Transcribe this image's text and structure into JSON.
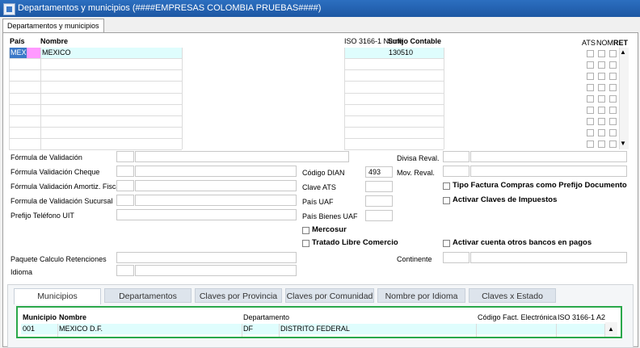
{
  "window": {
    "title": "Departamentos y municipios (####EMPRESAS COLOMBIA PRUEBAS####)"
  },
  "main_tab": "Departamentos y municipios",
  "grid": {
    "headers": {
      "pais": "País",
      "nombre": "Nombre",
      "iso": "ISO 3166-1 Nume",
      "sufijo": "Sufijo Contable",
      "ats": "ATS",
      "nom": "NOM.",
      "ret": "RET"
    },
    "row": {
      "pais": "MEX",
      "nombre": "MEXICO",
      "sufijo": "130510"
    }
  },
  "form": {
    "formula_validacion": "Fórmula de Validación",
    "formula_validacion_cheque": "Fórmula Validación Cheque",
    "formula_validacion_amortiz": "Fórmula Validación Amortiz. Fiscal",
    "formula_validacion_sucursal": "Formula de Validación Sucursal",
    "prefijo_telefono": "Prefijo Teléfono UIT",
    "paquete_calculo": "Paquete Calculo Retenciones",
    "idioma": "Idioma",
    "codigo_dian_label": "Código DIAN",
    "codigo_dian_value": "493",
    "clave_ats": "Clave ATS",
    "pais_uaf": "País UAF",
    "pais_bienes_uaf": "País Bienes UAF",
    "divisa_reval": "Divisa Reval.",
    "mov_reval": "Mov. Reval.",
    "continente": "Continente",
    "mercosur": "Mercosur",
    "tratado": "Tratado Libre Comercio",
    "tipo_factura": "Tipo Factura Compras como Prefijo Documento",
    "activar_claves": "Activar Claves de Impuestos",
    "activar_cuenta": "Activar cuenta otros bancos en pagos"
  },
  "subtabs": [
    "Municipios",
    "Departamentos",
    "Claves por Provincia",
    "Claves por Comunidad",
    "Nombre por Idioma",
    "Claves x Estado"
  ],
  "municipios": {
    "headers": {
      "municipio": "Municipio",
      "nombre": "Nombre",
      "departamento": "Departamento",
      "codigo_fact": "Código Fact. Electrónica",
      "iso": "ISO 3166-1 A2"
    },
    "row": {
      "municipio": "001",
      "nombre": "MEXICO D.F.",
      "dep_code": "DF",
      "dep_name": "DISTRITO FEDERAL"
    }
  },
  "colors": {
    "titlebar": "#1d57a3",
    "row_highlight": "#dffdfd",
    "pais_cell": "#ff99ff",
    "selected_code": "#3a78c8",
    "green_border": "#2aa84a"
  }
}
